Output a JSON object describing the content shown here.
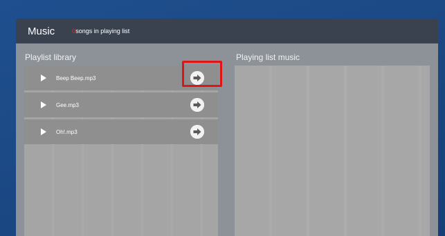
{
  "header": {
    "title": "Music",
    "song_count": "0",
    "song_count_suffix": "songs in playing list"
  },
  "library": {
    "title": "Playlist library",
    "songs": [
      {
        "name": "Beep Beep.mp3",
        "play_icon": "play-icon",
        "add_icon": "arrow-right-icon"
      },
      {
        "name": "Gee.mp3",
        "play_icon": "play-icon",
        "add_icon": "arrow-right-icon"
      },
      {
        "name": "Oh!.mp3",
        "play_icon": "play-icon",
        "add_icon": "arrow-right-icon"
      }
    ]
  },
  "playing": {
    "title": "Playing list music"
  },
  "colors": {
    "highlight": "#e01414",
    "count": "#e02b2b",
    "header_bg": "#3a4250"
  }
}
